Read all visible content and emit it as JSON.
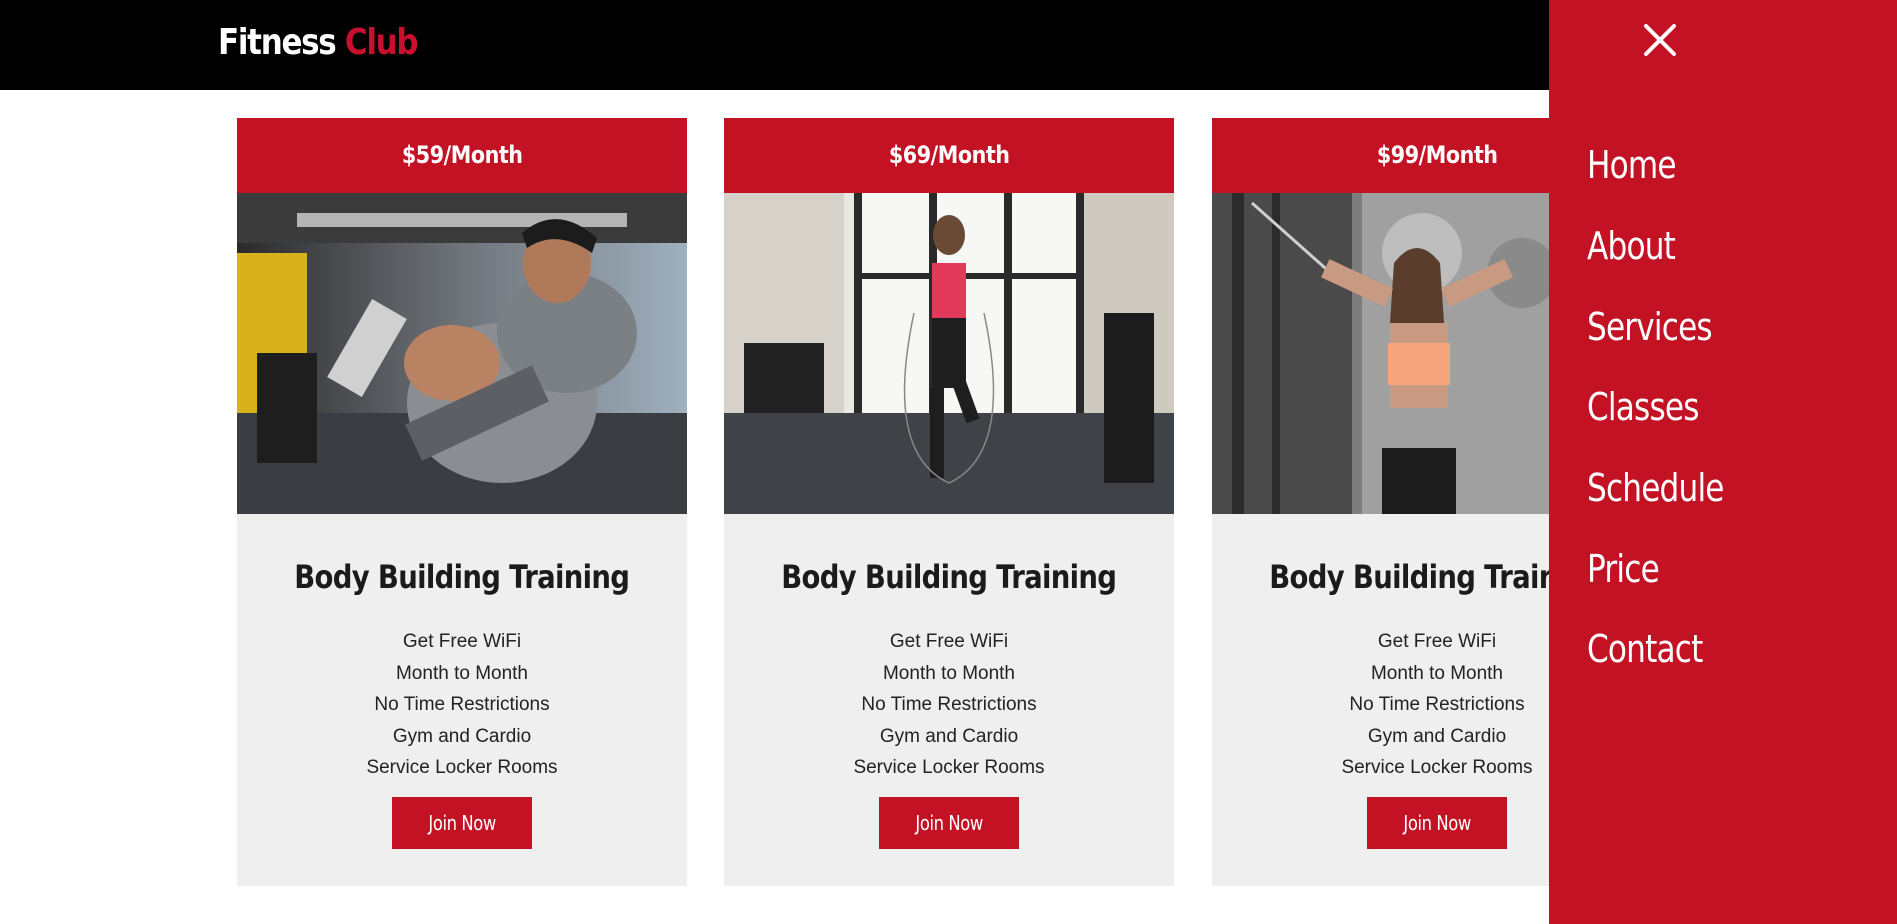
{
  "header": {
    "logo_part1": "Fitness",
    "logo_part2": "Club"
  },
  "colors": {
    "accent": "#c41225",
    "topbar": "#000000",
    "card_bg": "#efefef"
  },
  "cards": [
    {
      "price": "$59/Month",
      "image": "man-bicep-curl-photo",
      "title": "Body Building Training",
      "features": [
        "Get Free WiFi",
        "Month to Month",
        "No Time Restrictions",
        "Gym and Cardio",
        "Service Locker Rooms"
      ],
      "button": "Join Now"
    },
    {
      "price": "$69/Month",
      "image": "woman-jump-rope-photo",
      "title": "Body Building Training",
      "features": [
        "Get Free WiFi",
        "Month to Month",
        "No Time Restrictions",
        "Gym and Cardio",
        "Service Locker Rooms"
      ],
      "button": "Join Now"
    },
    {
      "price": "$99/Month",
      "image": "woman-cable-pull-photo",
      "title": "Body Building Training",
      "features": [
        "Get Free WiFi",
        "Month to Month",
        "No Time Restrictions",
        "Gym and Cardio",
        "Service Locker Rooms"
      ],
      "button": "Join Now"
    }
  ],
  "sidenav": {
    "close_icon": "close-icon",
    "items": [
      {
        "label": "Home"
      },
      {
        "label": "About"
      },
      {
        "label": "Services"
      },
      {
        "label": "Classes"
      },
      {
        "label": "Schedule"
      },
      {
        "label": "Price"
      },
      {
        "label": "Contact"
      }
    ]
  }
}
